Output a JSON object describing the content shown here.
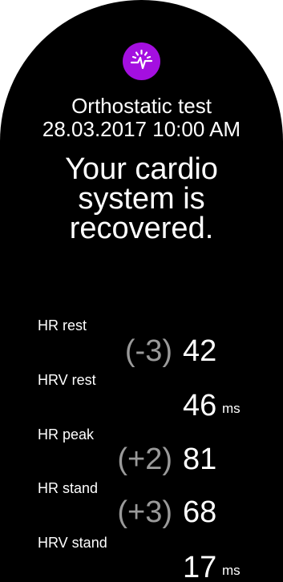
{
  "header": {
    "icon": "heart-pulse-icon",
    "accent_color": "#a40fe0",
    "title": "Orthostatic test",
    "datetime": "28.03.2017 10:00 AM"
  },
  "result": {
    "lines": [
      "Your cardio",
      "system is",
      "recovered."
    ]
  },
  "metrics": [
    {
      "label": "HR rest",
      "delta": "(-3)",
      "value": "42",
      "unit": ""
    },
    {
      "label": "HRV rest",
      "delta": "",
      "value": "46",
      "unit": "ms"
    },
    {
      "label": "HR peak",
      "delta": "(+2)",
      "value": "81",
      "unit": ""
    },
    {
      "label": "HR stand",
      "delta": "(+3)",
      "value": "68",
      "unit": ""
    },
    {
      "label": "HRV stand",
      "delta": "",
      "value": "17",
      "unit": "ms"
    }
  ]
}
